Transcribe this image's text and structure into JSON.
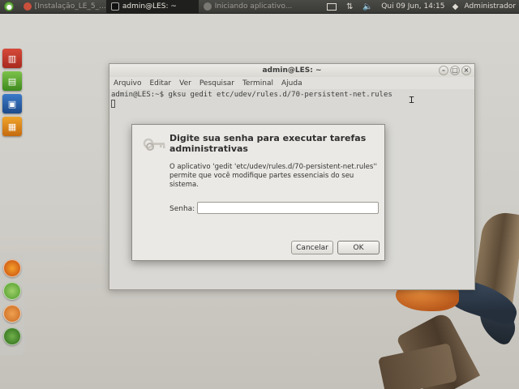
{
  "top_panel": {
    "tasks": [
      {
        "label": "[Instalação_LE_5_...",
        "active": false
      },
      {
        "label": "admin@LES: ~",
        "active": true
      },
      {
        "label": "Iniciando aplicativo...",
        "active": false
      }
    ],
    "clock": "Qui 09 Jun, 14:15",
    "user": "Administrador"
  },
  "terminal": {
    "title": "admin@LES: ~",
    "controls": {
      "minimize": "–",
      "maximize": "□",
      "close": "×"
    },
    "menu": [
      "Arquivo",
      "Editar",
      "Ver",
      "Pesquisar",
      "Terminal",
      "Ajuda"
    ],
    "line": "admin@LES:~$ gksu gedit etc/udev/rules.d/70-persistent-net.rules"
  },
  "dialog": {
    "title": "Digite sua senha para executar tarefas administrativas",
    "message": "O aplicativo 'gedit 'etc/udev/rules.d/70-persistent-net.rules'' permite que você modifique partes essenciais do seu sistema.",
    "password_label": "Senha:",
    "password_value": "",
    "cancel_label": "Cancelar",
    "ok_label": "OK"
  },
  "colors": {
    "panel": "#3a3a37",
    "desktop": "#d6d5d0",
    "bird_orange": "#e58a3a"
  }
}
